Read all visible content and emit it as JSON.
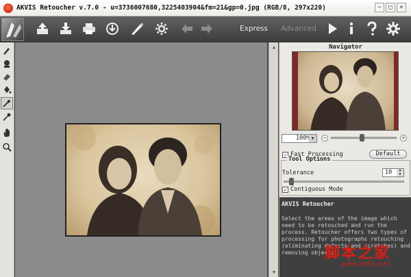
{
  "window": {
    "title": "AKVIS Retoucher v.7.0 - u=3736007680,3225403904&fm=21&gp=0.jpg (RGB/8, 297x220)",
    "minimize": "−",
    "maximize": "□",
    "close": "×"
  },
  "toolbar": {
    "buttons": [
      "open-icon",
      "save-icon",
      "print-icon",
      "share-icon",
      "brush-icon",
      "settings-gear-icon",
      "undo-arrow-icon",
      "redo-arrow-icon"
    ],
    "mode_express": "Express",
    "mode_advanced": "Advanced",
    "run_icon": "play-icon",
    "info_icon": "info-icon",
    "help_icon": "help-icon",
    "prefs_icon": "preferences-icon"
  },
  "tools": [
    "brush-icon",
    "stamp-icon",
    "eraser-icon",
    "fill-icon",
    "magic-wand-icon",
    "eyedropper-icon",
    "hand-icon",
    "zoom-icon"
  ],
  "navigator": {
    "title": "Navigator",
    "zoom": "100%",
    "zoom_level": 0.47
  },
  "settings": {
    "fast_processing_label": "Fast Processing",
    "fast_processing_checked": true,
    "default_button": "Default"
  },
  "tool_options": {
    "title": "Tool Options",
    "tolerance_label": "Tolerance",
    "tolerance_value": "10",
    "contiguous_label": "Contiguous Mode",
    "contiguous_checked": true
  },
  "help": {
    "title": "AKVIS Retoucher",
    "body": "Select the areas of the image which need to be retouched and run the process. Retoucher offers two types of processing for photographs retouching (eliminating defects and scratches) and removing objects."
  },
  "watermark": {
    "text_cn": "脚本之家",
    "url": "www.jb51.net"
  },
  "colors": {
    "toolbar_bg": "#4f4f4f",
    "canvas_bg": "#8b8b8b",
    "panel_bg": "#ebe9e3",
    "help_bg": "#3f3f3f",
    "watermark": "#d71f16"
  }
}
